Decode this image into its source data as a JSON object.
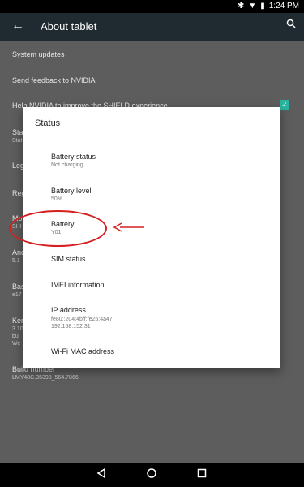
{
  "status_bar": {
    "time": "1:24 PM"
  },
  "toolbar": {
    "title": "About tablet"
  },
  "settings": {
    "items": [
      {
        "label": "System updates"
      },
      {
        "label": "Send feedback to NVIDIA"
      },
      {
        "label": "Help NVIDIA to improve the SHIELD experience"
      },
      {
        "label": "Stat",
        "sub": "Stat"
      },
      {
        "label": "Leg"
      },
      {
        "label": "Reg"
      },
      {
        "label": "Mo",
        "sub": "SHI"
      },
      {
        "label": "And",
        "sub": "5.1"
      },
      {
        "label": "Bas",
        "sub": "e17"
      },
      {
        "label": "Ker",
        "sub1": "3.10",
        "sub2": "bui",
        "sub3": "We"
      },
      {
        "label": "Build number",
        "sub": "LMY48C.35398_564.7866"
      }
    ]
  },
  "dialog": {
    "title": "Status",
    "items": [
      {
        "label": "Battery status",
        "sub": "Not charging"
      },
      {
        "label": "Battery level",
        "sub": "50%"
      },
      {
        "label": "Battery",
        "sub": "Y01"
      },
      {
        "label": "SIM status"
      },
      {
        "label": "IMEI information"
      },
      {
        "label": "IP address",
        "sub1": "fe80::204:4bff:fe25:4a47",
        "sub2": "192.168.152.31"
      },
      {
        "label": "Wi-Fi MAC address"
      }
    ]
  },
  "colors": {
    "annotation": "#d62020",
    "accent": "#28b6a2",
    "toolbar": "#1f2b30"
  }
}
